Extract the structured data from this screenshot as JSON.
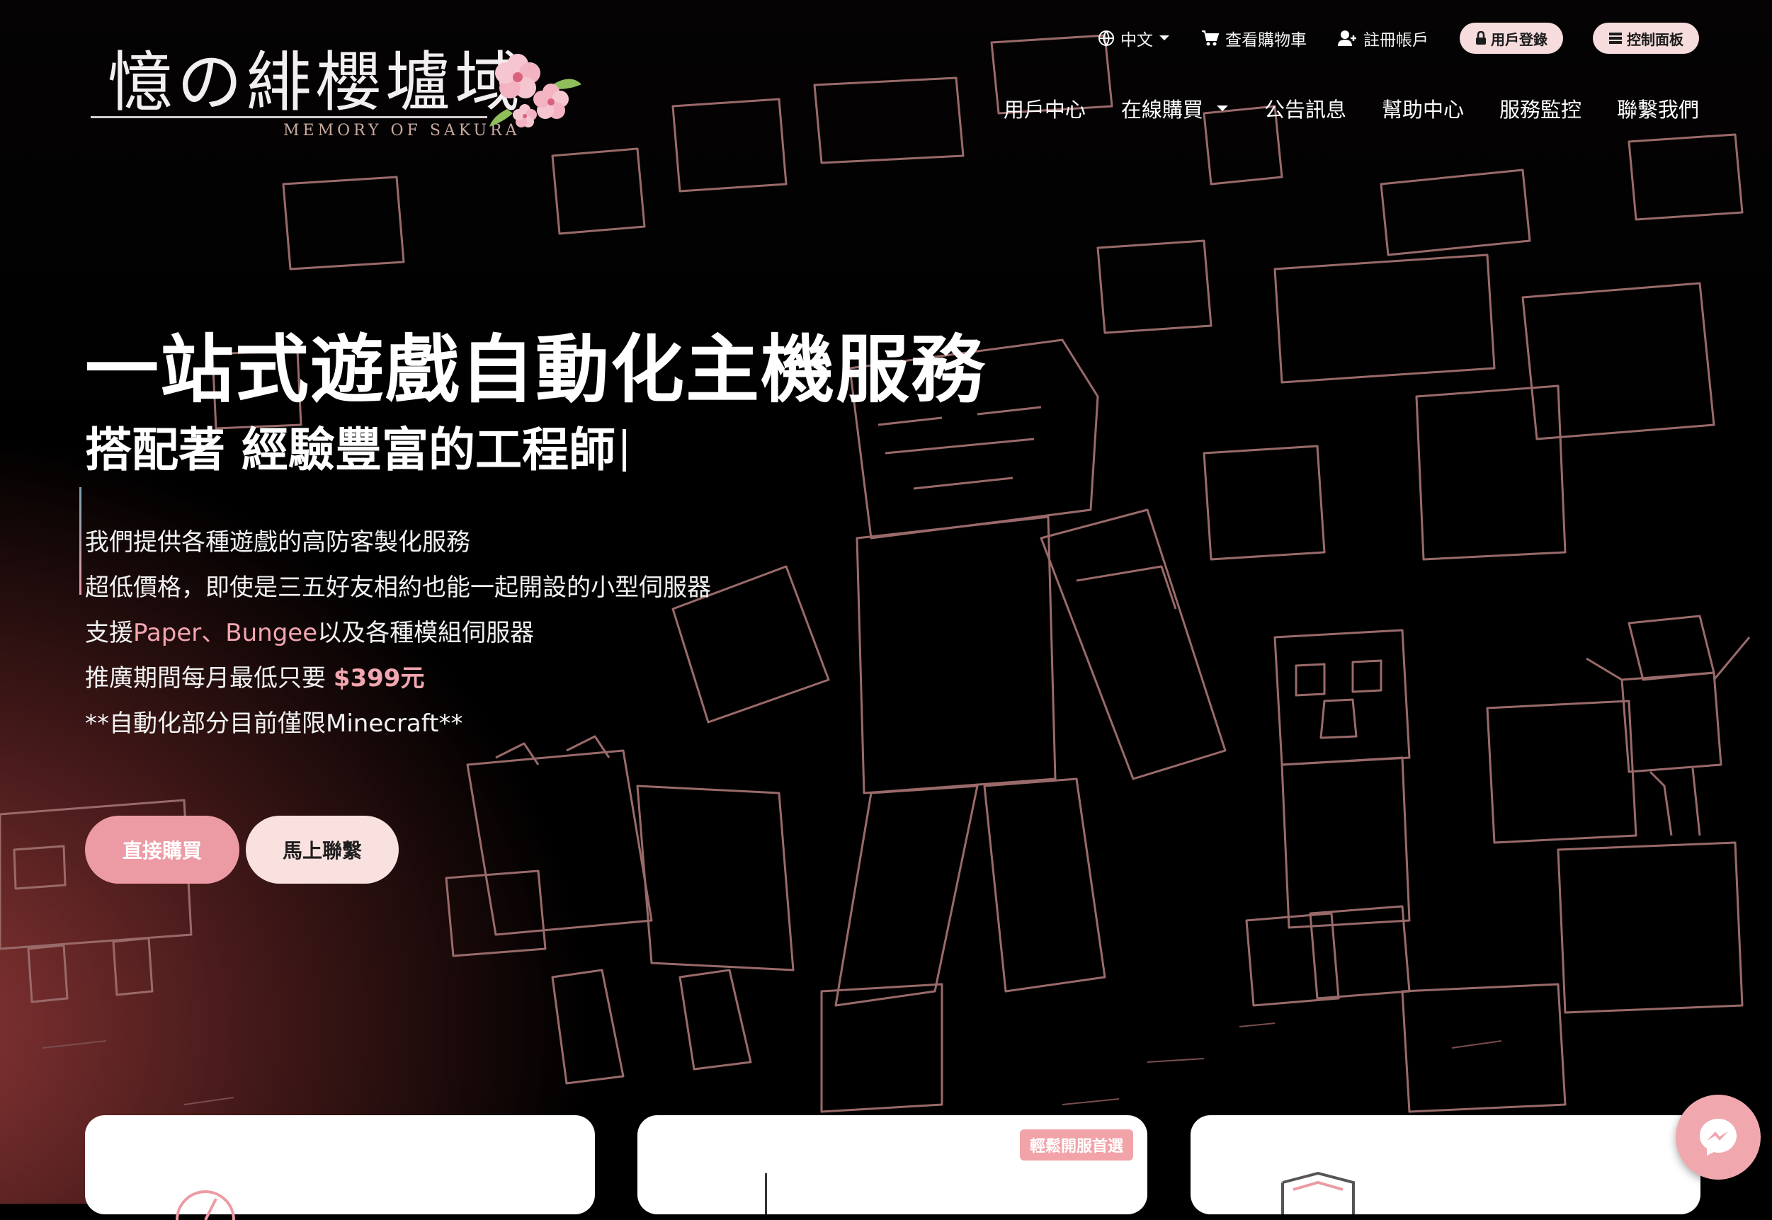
{
  "brand": {
    "logo_text": "憶の緋櫻壚域",
    "logo_subtitle": "MEMORY OF SAKURA"
  },
  "topbar": {
    "language": "中文",
    "cart": "查看購物車",
    "register": "註冊帳戶",
    "login": "用戶登錄",
    "dashboard": "控制面板"
  },
  "nav": {
    "items": [
      "用戶中心",
      "在線購買",
      "公告訊息",
      "幫助中心",
      "服務監控",
      "聯繫我們"
    ]
  },
  "hero": {
    "title": "一站式遊戲自動化主機服務",
    "subtitle": "搭配著 經驗豐富的工程師",
    "lines": {
      "l1": "我們提供各種遊戲的高防客製化服務",
      "l2": "超低價格，即使是三五好友相約也能一起開設的小型伺服器",
      "l3_pre": "支援",
      "l3_hl": "Paper、Bungee",
      "l3_post": "以及各種模組伺服器",
      "l4_pre": "推廣期間每月最低只要 ",
      "l4_price": "$399元",
      "l5": "**自動化部分目前僅限Minecraft**"
    },
    "buy_button": "直接購買",
    "contact_button": "馬上聯繫"
  },
  "cards": {
    "badge": "輕鬆開服首選"
  },
  "colors": {
    "accent_pink": "#ec9ba4",
    "light_pink": "#f8e1df",
    "outline": "#a87373"
  }
}
